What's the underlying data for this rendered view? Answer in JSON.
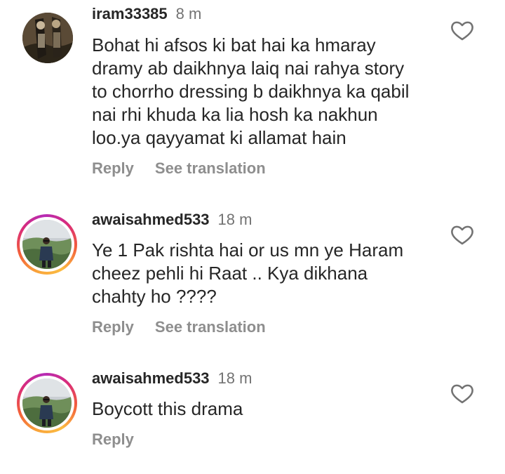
{
  "comments": [
    {
      "username": "iram33385",
      "time": "8 m",
      "lines": [
        "Bohat hi afsos ki bat hai ka hmaray",
        "dramy ab daikhnya laiq nai rahya story",
        "to chorrho dressing b daikhnya ka qabil",
        "nai rhi khuda ka lia hosh ka nakhun",
        "loo.ya qayyamat ki allamat hain"
      ],
      "reply_label": "Reply",
      "translate_label": "See translation",
      "like_icon": "heart-outline-icon",
      "avatar_story_ring": false
    },
    {
      "username": "awaisahmed533",
      "time": "18 m",
      "lines": [
        "Ye 1 Pak rishta hai or us mn ye Haram",
        "cheez pehli hi Raat .. Kya dikhana",
        "chahty ho ????"
      ],
      "reply_label": "Reply",
      "translate_label": "See translation",
      "like_icon": "heart-outline-icon",
      "avatar_story_ring": true
    },
    {
      "username": "awaisahmed533",
      "time": "18 m",
      "lines": [
        "Boycott this drama"
      ],
      "reply_label": "Reply",
      "like_icon": "heart-outline-icon",
      "avatar_story_ring": true
    }
  ],
  "colors": {
    "username": "#262626",
    "body_text": "#262626",
    "secondary_text": "#737373",
    "action_text": "#8e8e8e",
    "story_ring_start": "#f9a43a",
    "story_ring_end": "#b62bb5"
  }
}
